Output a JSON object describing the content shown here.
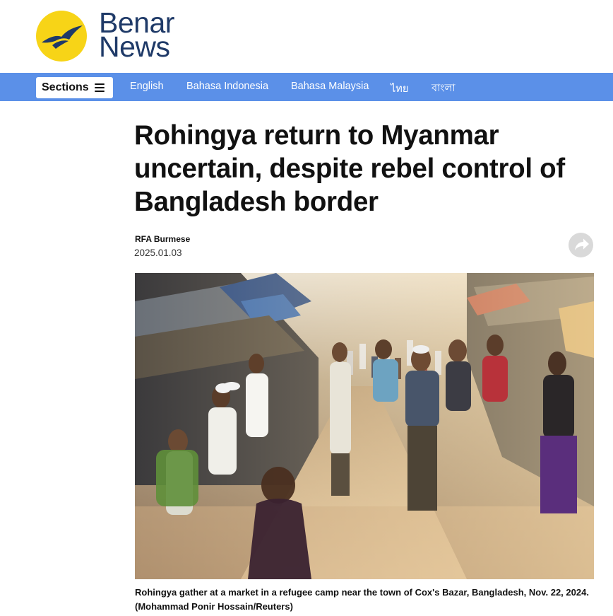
{
  "brand": {
    "name_line1": "Benar",
    "name_line2": "News",
    "logo_icon": "bird-in-sun-icon",
    "logo_yellow": "#f7d417",
    "logo_navy": "#1f3a68"
  },
  "nav": {
    "background": "#5b90e8",
    "sections_label": "Sections",
    "sections_icon": "hamburger-menu-icon",
    "languages": [
      "English",
      "Bahasa Indonesia",
      "Bahasa Malaysia",
      "ไทย",
      "বাংলা"
    ]
  },
  "article": {
    "headline": "Rohingya return to Myanmar uncertain, despite rebel control of Bangladesh border",
    "byline": "RFA Burmese",
    "date": "2025.01.03",
    "share_icon": "share-arrow-icon",
    "photo_subject": "crowd-at-refugee-camp-market-photo",
    "caption": "Rohingya gather at a market in a refugee camp near the town of Cox's Bazar, Bangladesh, Nov. 22, 2024. (Mohammad Ponir Hossain/Reuters)"
  }
}
